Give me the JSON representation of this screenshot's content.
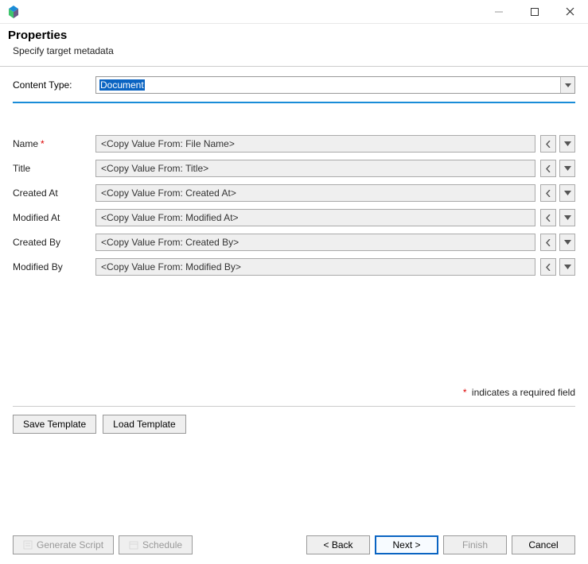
{
  "window": {
    "title": ""
  },
  "header": {
    "title": "Properties",
    "subtitle": "Specify target metadata"
  },
  "contentType": {
    "label": "Content Type:",
    "value": "Document"
  },
  "fields": [
    {
      "label": "Name",
      "required": true,
      "value": "<Copy Value From: File Name>"
    },
    {
      "label": "Title",
      "required": false,
      "value": "<Copy Value From: Title>"
    },
    {
      "label": "Created At",
      "required": false,
      "value": "<Copy Value From: Created At>"
    },
    {
      "label": "Modified At",
      "required": false,
      "value": "<Copy Value From: Modified At>"
    },
    {
      "label": "Created By",
      "required": false,
      "value": "<Copy Value From: Created By>"
    },
    {
      "label": "Modified By",
      "required": false,
      "value": "<Copy Value From: Modified By>"
    }
  ],
  "requiredNote": "indicates a required field",
  "templateButtons": {
    "save": "Save Template",
    "load": "Load Template"
  },
  "bottomButtons": {
    "generateScript": "Generate Script",
    "schedule": "Schedule",
    "back": "< Back",
    "next": "Next >",
    "finish": "Finish",
    "cancel": "Cancel"
  }
}
